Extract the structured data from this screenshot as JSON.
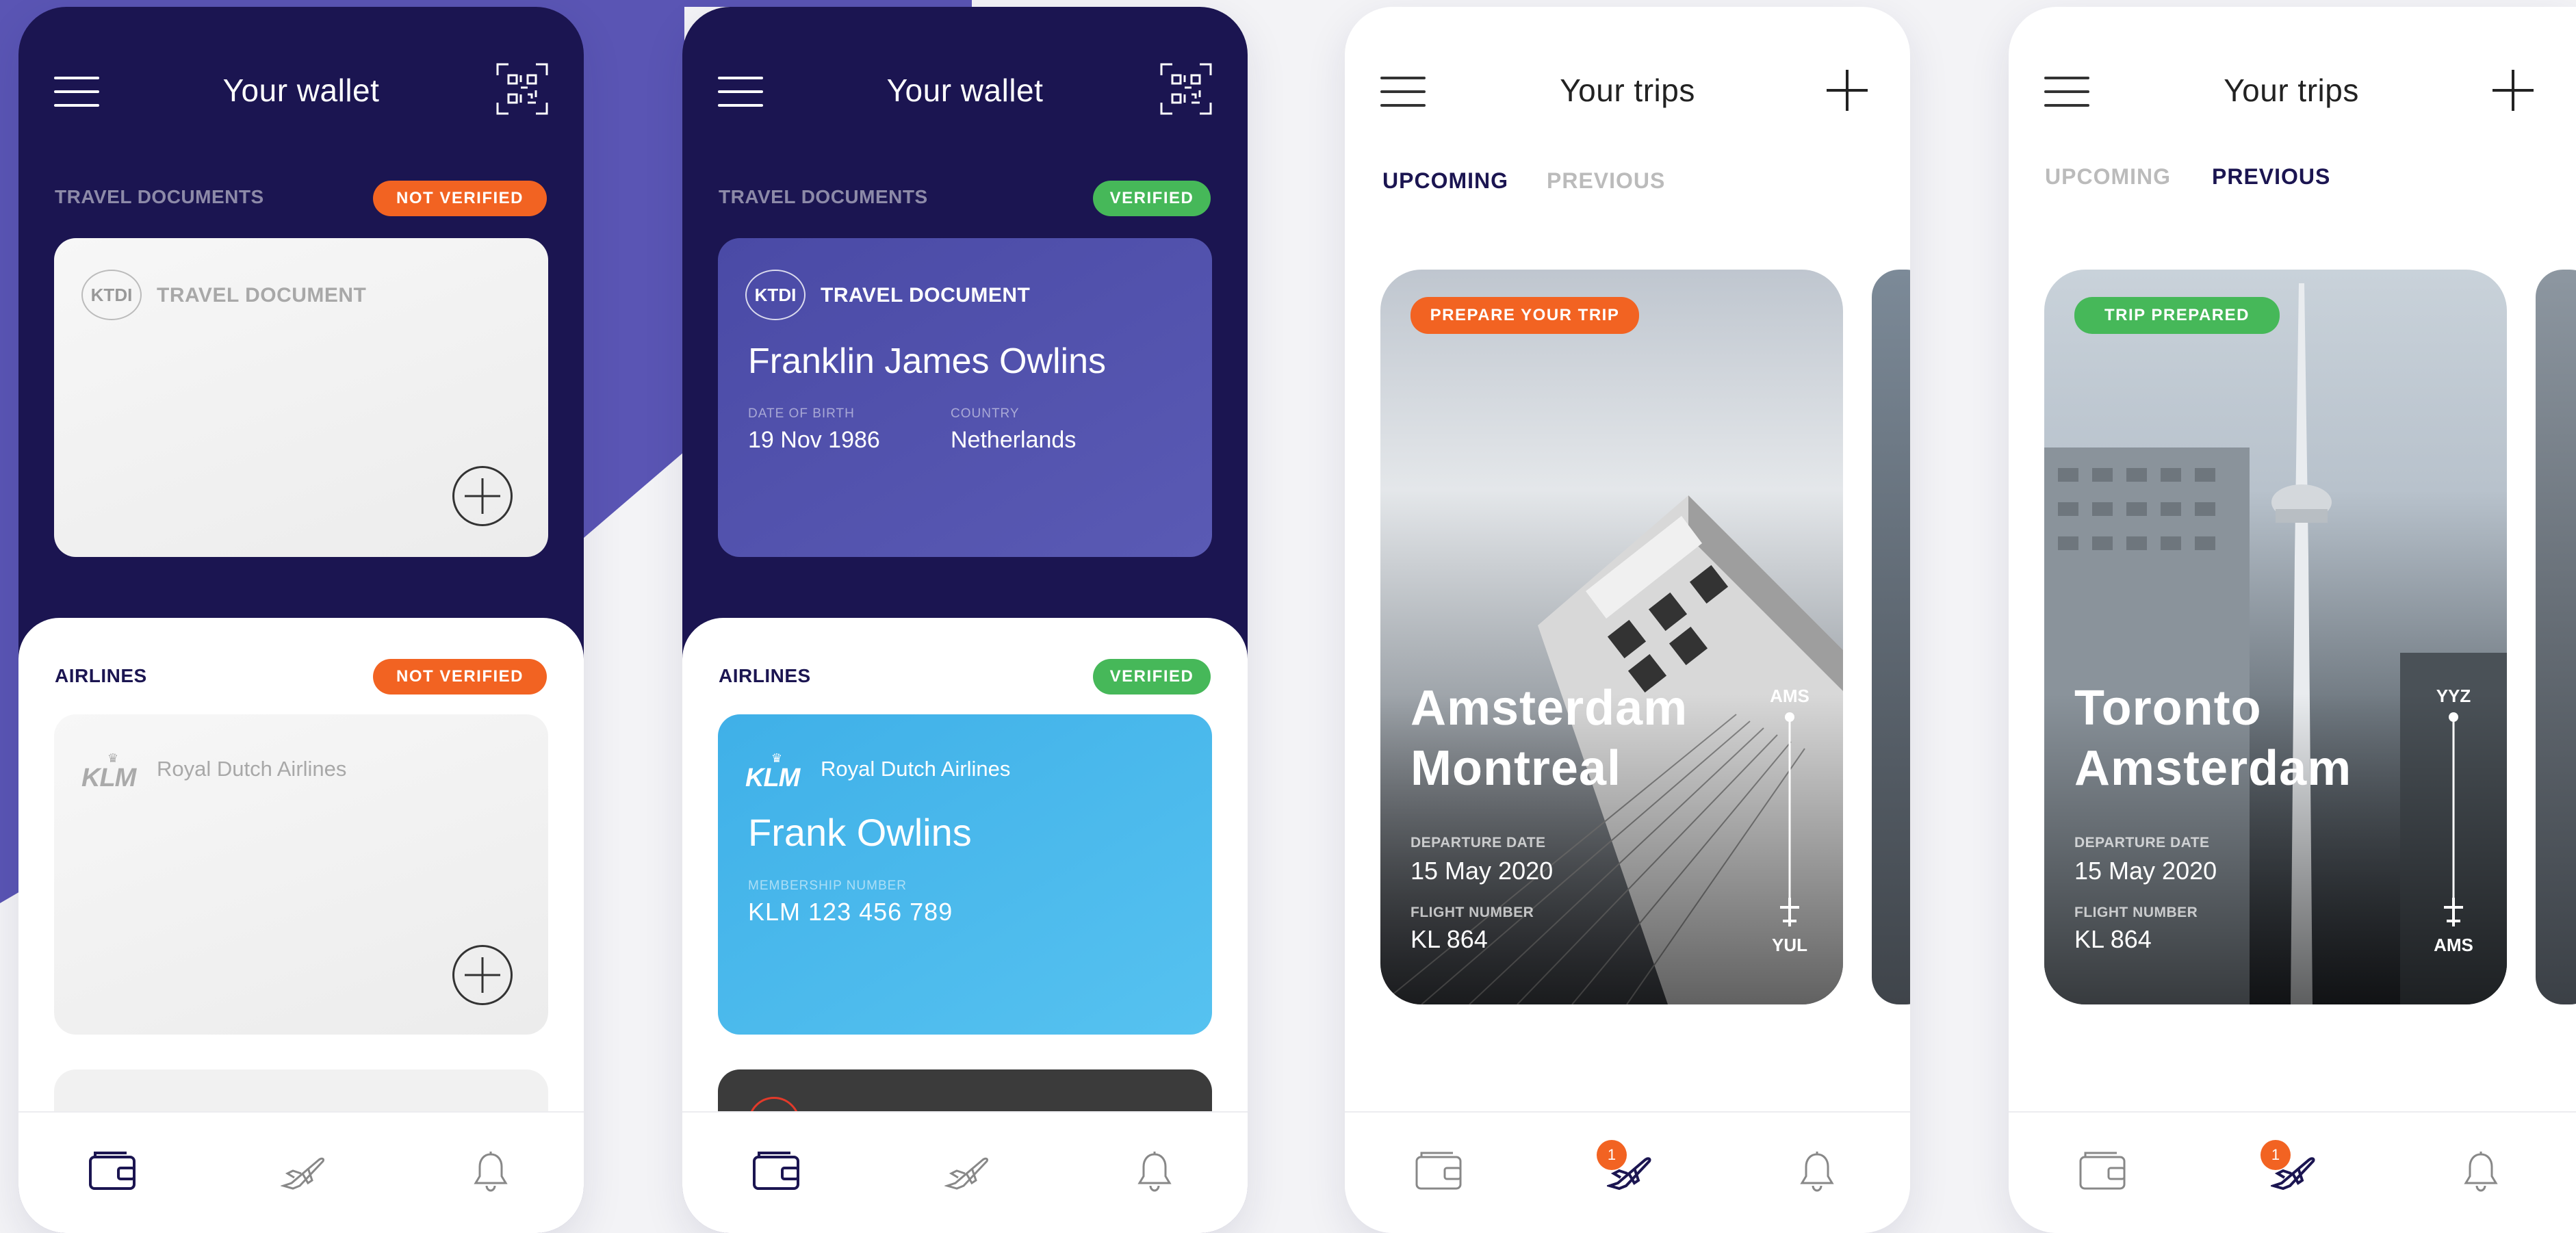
{
  "colors": {
    "navy": "#1b1551",
    "orange": "#f26322",
    "green": "#46b859",
    "klm_blue": "#47b8ec",
    "doc_purple": "#4f4fa8"
  },
  "screens": [
    {
      "title": "Your wallet",
      "travel_section": "TRAVEL DOCUMENTS",
      "travel_badge": "NOT VERIFIED",
      "doc_logo": "KTDI",
      "doc_title": "TRAVEL DOCUMENT",
      "airlines_section": "AIRLINES",
      "airlines_badge": "NOT VERIFIED",
      "airline_logo": "KLM",
      "airline_name": "Royal Dutch Airlines"
    },
    {
      "title": "Your wallet",
      "travel_section": "TRAVEL DOCUMENTS",
      "travel_badge": "VERIFIED",
      "doc_logo": "KTDI",
      "doc_title": "TRAVEL DOCUMENT",
      "holder_name": "Franklin James Owlins",
      "dob_label": "DATE OF BIRTH",
      "dob_value": "19 Nov 1986",
      "country_label": "COUNTRY",
      "country_value": "Netherlands",
      "airlines_section": "AIRLINES",
      "airlines_badge": "VERIFIED",
      "airline_logo": "KLM",
      "airline_name": "Royal Dutch Airlines",
      "member_name": "Frank Owlins",
      "membership_label": "MEMBERSHIP NUMBER",
      "membership_value": "KLM 123 456 789"
    },
    {
      "title": "Your trips",
      "tab_upcoming": "UPCOMING",
      "tab_previous": "PREVIOUS",
      "active_tab": "UPCOMING",
      "trip_badge": "PREPARE YOUR TRIP",
      "city_from": "Amsterdam",
      "city_to": "Montreal",
      "departure_label": "DEPARTURE DATE",
      "departure_value": "15 May 2020",
      "flight_label": "FLIGHT NUMBER",
      "flight_value": "KL 864",
      "code_from": "AMS",
      "code_to": "YUL",
      "notification_count": "1"
    },
    {
      "title": "Your trips",
      "tab_upcoming": "UPCOMING",
      "tab_previous": "PREVIOUS",
      "active_tab": "PREVIOUS",
      "trip_badge": "TRIP PREPARED",
      "city_from": "Toronto",
      "city_to": "Amsterdam",
      "departure_label": "DEPARTURE DATE",
      "departure_value": "15 May 2020",
      "flight_label": "FLIGHT NUMBER",
      "flight_value": "KL 864",
      "code_from": "YYZ",
      "code_to": "AMS",
      "notification_count": "1"
    }
  ],
  "nav_icons": [
    "wallet-icon",
    "plane-icon",
    "bell-icon"
  ]
}
